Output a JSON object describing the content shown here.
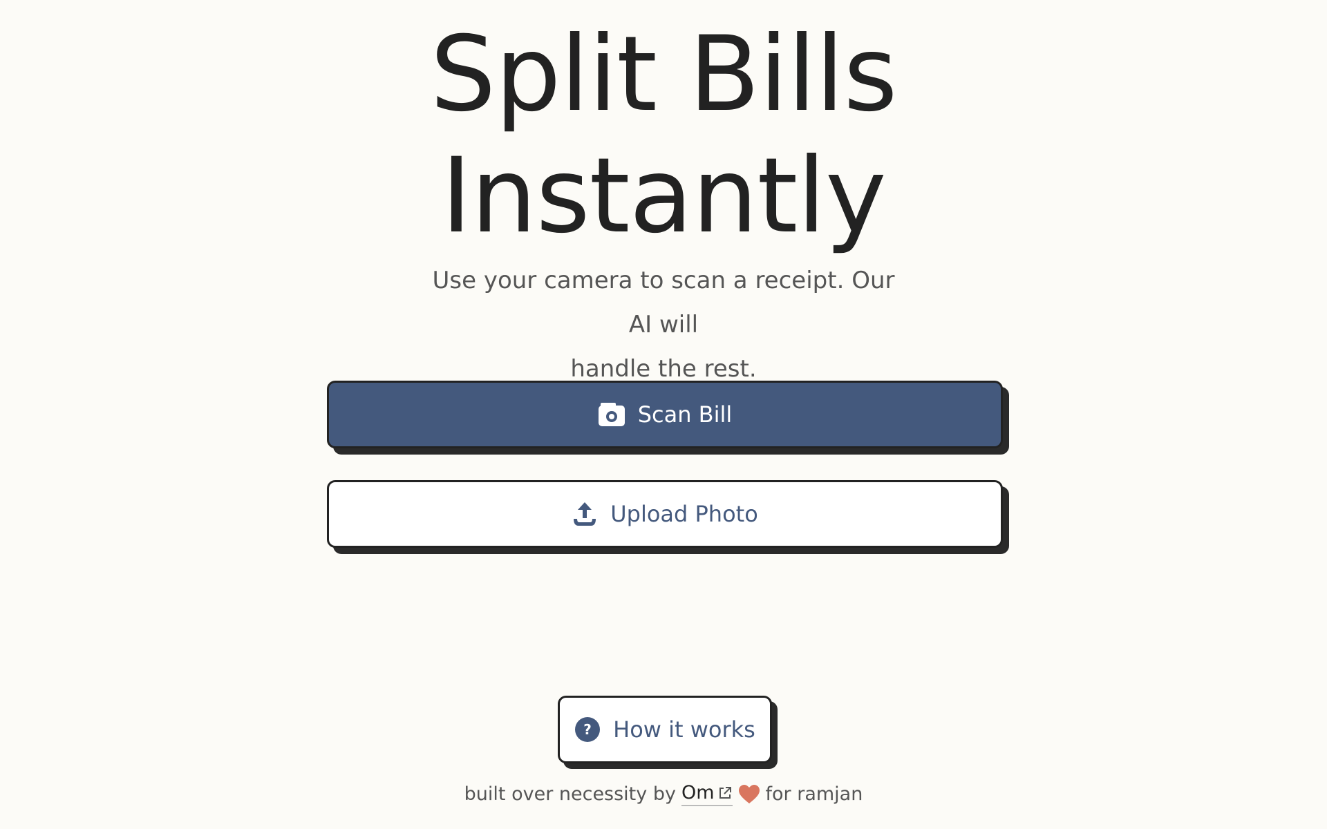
{
  "hero": {
    "title_line1": "Split Bills",
    "title_line2": "Instantly",
    "subtitle_line1": "Use your camera to scan a receipt. Our AI will",
    "subtitle_line2": "handle the rest."
  },
  "actions": {
    "scan_label": "Scan Bill",
    "scan_icon": "camera-icon",
    "upload_label": "Upload Photo",
    "upload_icon": "upload-icon",
    "help_label": "How it works",
    "help_icon": "question-circle-icon"
  },
  "footer": {
    "prefix": "built over necessity by",
    "author": "Om",
    "author_icon": "external-link-icon",
    "heart_icon": "heart-icon",
    "suffix": "for ramjan"
  },
  "colors": {
    "background": "#fcfbf7",
    "primary": "#44597d",
    "text": "#222222",
    "muted_text": "#555555",
    "heart": "#d9765f",
    "shadow": "#2a2a2a"
  }
}
